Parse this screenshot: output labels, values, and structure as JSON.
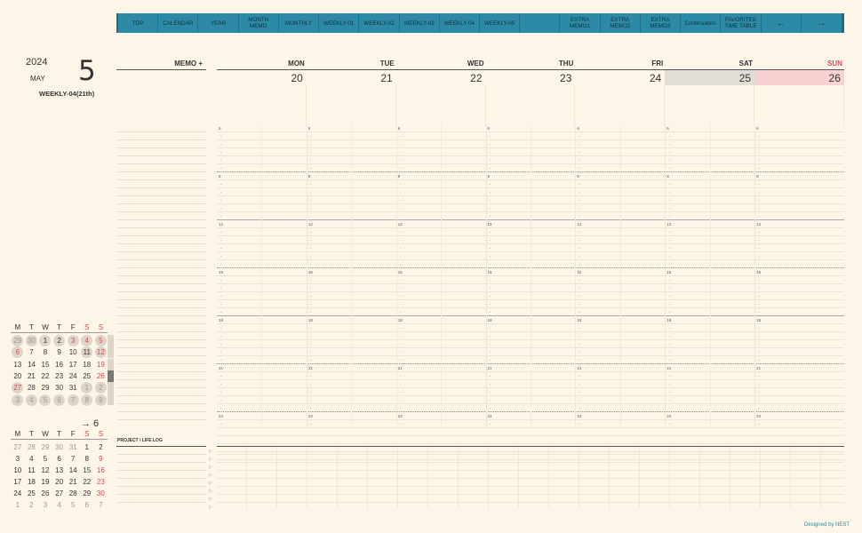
{
  "nav": {
    "tabs": [
      "TOP",
      "CALENDAR",
      "YEAR",
      "MONTH MEMO",
      "MONTHLY",
      "WEEKLY-01",
      "WEEKLY-02",
      "WEEKLY-03",
      "WEEKLY-04",
      "WEEKLY-05",
      "",
      "EXTRA\nMEMO1",
      "EXTRA\nMEMO2",
      "EXTRA\nMEMO3",
      "Continuation",
      "FAVORITES\nTIME TABLE",
      "←",
      "→"
    ]
  },
  "header": {
    "year": "2024",
    "month": "MAY",
    "big_day": "5",
    "week_name": "WEEKLY-04(21th)"
  },
  "memo_label": "MEMO +",
  "days": {
    "names": [
      "MON",
      "TUE",
      "WED",
      "THU",
      "FRI",
      "SAT",
      "SUN"
    ],
    "dates": [
      "20",
      "21",
      "22",
      "23",
      "24",
      "25",
      "26"
    ]
  },
  "hour_labels": [
    "6",
    "9",
    "12",
    "15",
    "18",
    "21",
    "24"
  ],
  "mini_current": {
    "weekdays": [
      "M",
      "T",
      "W",
      "T",
      "F",
      "S",
      "S"
    ],
    "rows": [
      [
        "29",
        "30",
        "1",
        "2",
        "3",
        "4",
        "5"
      ],
      [
        "6",
        "7",
        "8",
        "9",
        "10",
        "11",
        "12"
      ],
      [
        "13",
        "14",
        "15",
        "16",
        "17",
        "18",
        "19"
      ],
      [
        "20",
        "21",
        "22",
        "23",
        "24",
        "25",
        "26"
      ],
      [
        "27",
        "28",
        "29",
        "30",
        "31",
        "1",
        "2"
      ],
      [
        "3",
        "4",
        "5",
        "6",
        "7",
        "8",
        "9"
      ]
    ]
  },
  "mini_next": {
    "label": "→ 6",
    "weekdays": [
      "M",
      "T",
      "W",
      "T",
      "F",
      "S",
      "S"
    ],
    "rows": [
      [
        "27",
        "28",
        "29",
        "30",
        "31",
        "1",
        "2"
      ],
      [
        "3",
        "4",
        "5",
        "6",
        "7",
        "8",
        "9"
      ],
      [
        "10",
        "11",
        "12",
        "13",
        "14",
        "15",
        "16"
      ],
      [
        "17",
        "18",
        "19",
        "20",
        "21",
        "22",
        "23"
      ],
      [
        "24",
        "25",
        "26",
        "27",
        "28",
        "29",
        "30"
      ],
      [
        "1",
        "2",
        "3",
        "4",
        "5",
        "6",
        "7"
      ]
    ]
  },
  "project_label": "PROJECT / LIFE LOG",
  "credit": "Designed by NEST",
  "colors": {
    "nav": "#2d8aa6",
    "background": "#fdf6e8",
    "sunday": "#d9475a",
    "saturday_bg": "#e2ddd6",
    "sunday_bg": "#f6d2d2"
  }
}
